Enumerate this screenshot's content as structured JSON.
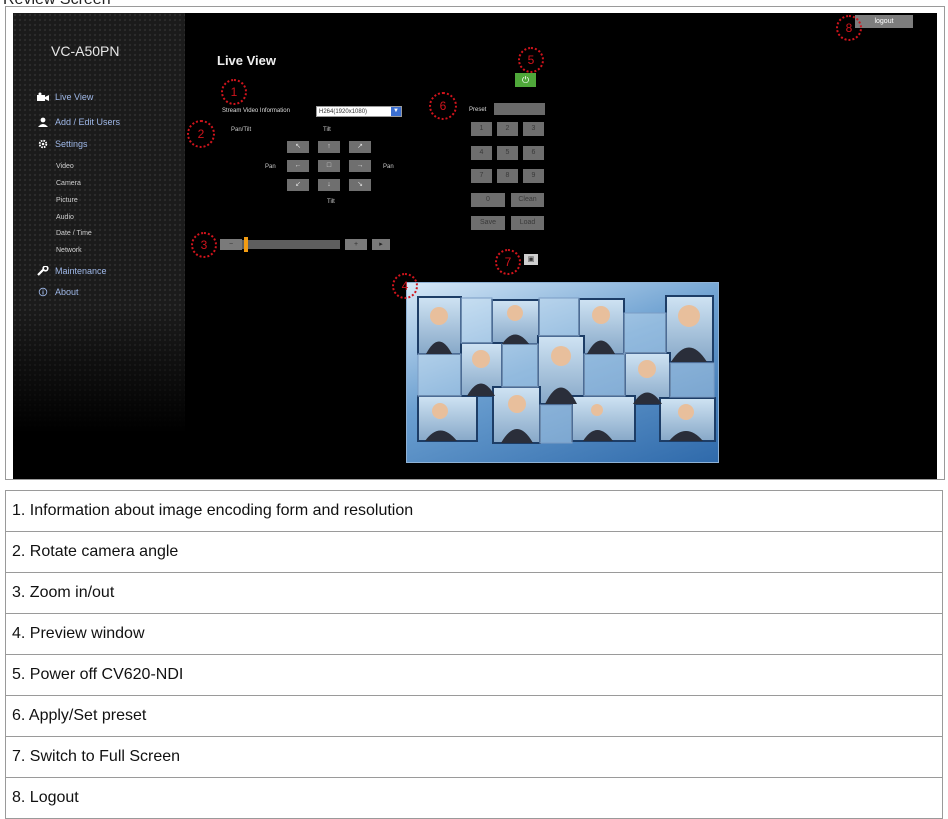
{
  "page": {
    "top_caption": "Review Screen"
  },
  "app": {
    "model": "VC-A50PN",
    "page_title": "Live View",
    "logout_label": "logout"
  },
  "sidebar": {
    "items": [
      {
        "label": "Live View",
        "icon": "camera-icon"
      },
      {
        "label": "Add / Edit Users",
        "icon": "user-icon"
      },
      {
        "label": "Settings",
        "icon": "gear-icon"
      },
      {
        "label": "Maintenance",
        "icon": "wrench-icon"
      },
      {
        "label": "About",
        "icon": "info-icon"
      }
    ],
    "settings_subitems": [
      "Video",
      "Camera",
      "Picture",
      "Audio",
      "Date / Time",
      "Network"
    ]
  },
  "stream": {
    "label": "Stream Video Information",
    "value": "H264(1920x1080)"
  },
  "ptz": {
    "pantilt_label": "Pan/Tilt",
    "tilt_label": "Tilt",
    "pan_label": "Pan",
    "buttons": [
      "↖",
      "↑",
      "↗",
      "←",
      "□",
      "→",
      "↙",
      "↓",
      "↘"
    ]
  },
  "zoom": {
    "minus": "−",
    "plus": "+",
    "extra": "▸"
  },
  "power": {
    "symbol": "⏻"
  },
  "preset": {
    "label": "Preset",
    "keys": [
      "1",
      "2",
      "3",
      "4",
      "5",
      "6",
      "7",
      "8",
      "9",
      "0",
      "Clean",
      "Save",
      "Load"
    ]
  },
  "fullscreen": {
    "symbol": "▣"
  },
  "markers": [
    "1",
    "2",
    "3",
    "4",
    "5",
    "6",
    "7",
    "8"
  ],
  "legend": [
    "1. Information about image encoding form and resolution",
    "2. Rotate camera angle",
    "3. Zoom in/out",
    "4. Preview window",
    "5. Power off CV620-NDI",
    "6. Apply/Set preset",
    "7. Switch to Full Screen",
    "8. Logout"
  ],
  "colors": {
    "screen_bg": "#000000",
    "marker": "#d0141c",
    "power_button": "#4fa83a",
    "zoom_knob": "#f39c12",
    "nav_text": "#9fb8e8"
  }
}
